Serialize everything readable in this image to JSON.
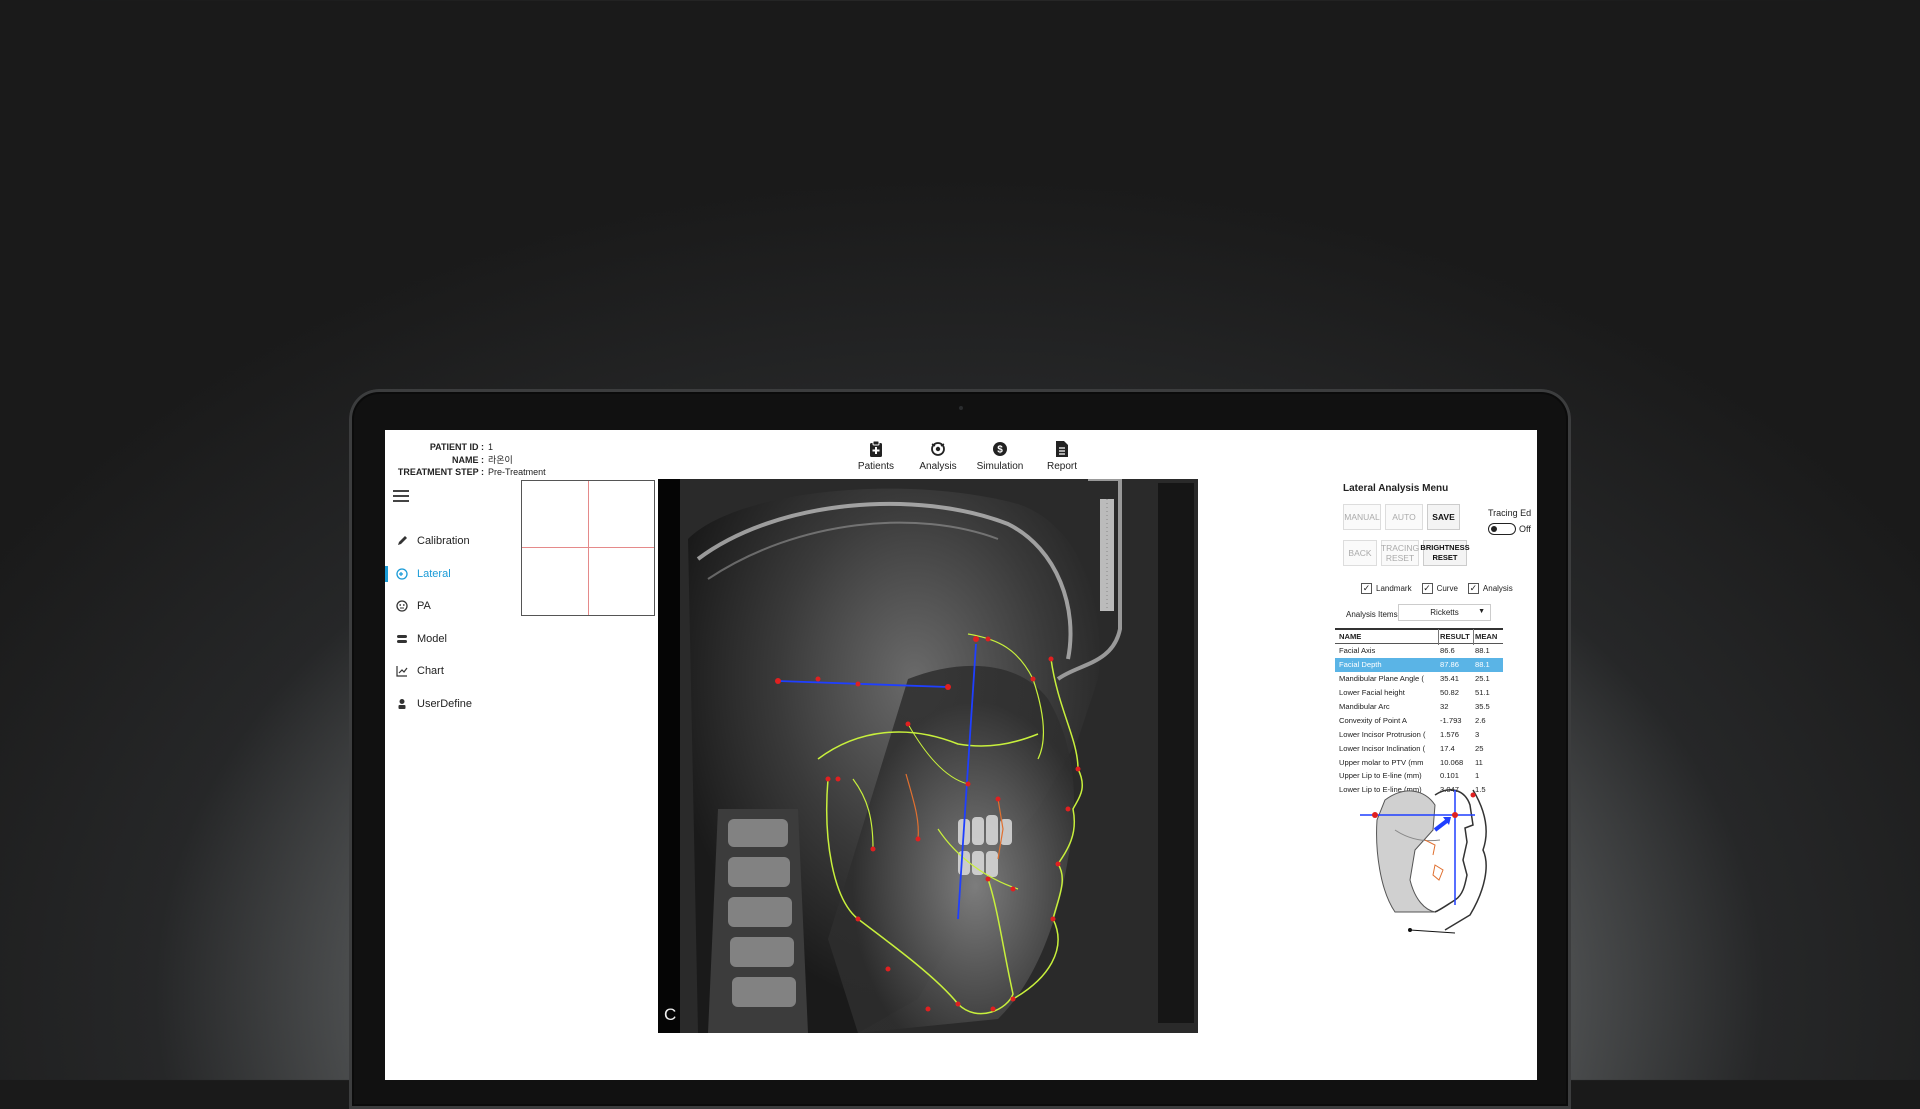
{
  "patient": {
    "id_label": "PATIENT ID :",
    "id_value": "1",
    "name_label": "NAME :",
    "name_value": "라온이",
    "step_label": "TREATMENT STEP :",
    "step_value": "Pre-Treatment"
  },
  "toolbar": [
    {
      "label": "Patients",
      "icon": "clipboard-plus-icon"
    },
    {
      "label": "Analysis",
      "icon": "analysis-icon"
    },
    {
      "label": "Simulation",
      "icon": "dollar-circle-icon"
    },
    {
      "label": "Report",
      "icon": "document-icon"
    }
  ],
  "nav": {
    "items": [
      {
        "label": "Calibration",
        "icon": "pencil-icon"
      },
      {
        "label": "Lateral",
        "icon": "lateral-icon",
        "active": true
      },
      {
        "label": "PA",
        "icon": "pa-icon"
      },
      {
        "label": "Model",
        "icon": "model-icon"
      },
      {
        "label": "Chart",
        "icon": "chart-icon"
      },
      {
        "label": "UserDefine",
        "icon": "user-icon"
      }
    ]
  },
  "xray": {
    "corner_label": "C"
  },
  "panel": {
    "title": "Lateral Analysis Menu",
    "buttons": {
      "manual": "MANUAL",
      "auto": "AUTO",
      "save": "SAVE",
      "back": "BACK",
      "tracing_reset": "TRACING RESET",
      "brightness_reset": "BRIGHTNESS RESET"
    },
    "tracing_edit_label": "Tracing Ed",
    "tracing_edit_state": "Off",
    "checkboxes": [
      {
        "label": "Landmark",
        "checked": true
      },
      {
        "label": "Curve",
        "checked": true
      },
      {
        "label": "Analysis",
        "checked": true
      }
    ],
    "analysis_items_label": "Analysis Items",
    "analysis_items_value": "Ricketts",
    "table": {
      "headers": [
        "NAME",
        "RESULT",
        "MEAN"
      ],
      "rows": [
        [
          "Facial Axis",
          "86.6",
          "88.1"
        ],
        [
          "Facial Depth",
          "87.86",
          "88.1"
        ],
        [
          "Mandibular Plane Angle (",
          "35.41",
          "25.1"
        ],
        [
          "Lower Facial height",
          "50.82",
          "51.1"
        ],
        [
          "Mandibular Arc",
          "32",
          "35.5"
        ],
        [
          "Convexity of Point A",
          "-1.793",
          "2.6"
        ],
        [
          "Lower Incisor Protrusion (",
          "1.576",
          "3"
        ],
        [
          "Lower Incisor Inclination (",
          "17.4",
          "25"
        ],
        [
          "Upper molar to PTV (mm",
          "10.068",
          "11"
        ],
        [
          "Upper Lip to E-line (mm)",
          "0.101",
          "1"
        ],
        [
          "Lower Lip to E-line (mm)",
          "3.047",
          "1.5"
        ]
      ],
      "selected_row": 1
    }
  },
  "colors": {
    "accent": "#1a9bd7",
    "selected_row": "#5ab4e6",
    "tracing": "#c8f03c",
    "landmark": "#e02020",
    "axis_line": "#1f3fff"
  }
}
